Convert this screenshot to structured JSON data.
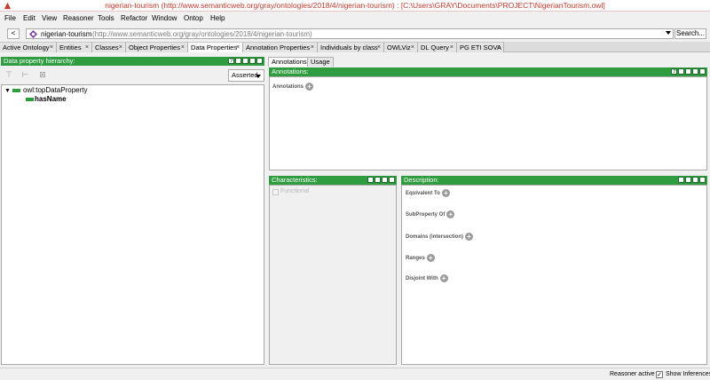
{
  "window": {
    "title": "nigerian-tourism (http://www.semanticweb.org/gray/ontologies/2018/4/nigerian-tourism)  : [C:\\Users\\GRAY\\Documents\\PROJECT\\NigerianTourism.owl]"
  },
  "menu": [
    "File",
    "Edit",
    "View",
    "Reasoner",
    "Tools",
    "Refactor",
    "Window",
    "Ontop",
    "Help"
  ],
  "address": {
    "back": "<",
    "ontology_name": "nigerian-tourism",
    "ontology_iri": "(http://www.semanticweb.org/gray/ontologies/2018/4/nigerian-tourism)",
    "search_label": "Search..."
  },
  "tabs": [
    {
      "label": "Active Ontology",
      "close": "×"
    },
    {
      "label": "Entities",
      "close": "×"
    },
    {
      "label": "Classes",
      "close": "×"
    },
    {
      "label": "Object Properties",
      "close": "×"
    },
    {
      "label": "Data Properties",
      "close": "×"
    },
    {
      "label": "Annotation Properties",
      "close": "×"
    },
    {
      "label": "Individuals by class",
      "close": "×"
    },
    {
      "label": "OWLViz",
      "close": "×"
    },
    {
      "label": "DL Query",
      "close": "×"
    },
    {
      "label": "PG ETI SOVA",
      "close": "×"
    }
  ],
  "left_panel": {
    "title": "Data property hierarchy:",
    "mode": "Asserted",
    "tree": {
      "root": "owl:topDataProperty",
      "children": [
        "hasName"
      ]
    }
  },
  "right_tabs": [
    "Annotations",
    "Usage"
  ],
  "annotations_panel": {
    "title": "Annotations:",
    "label": "Annotations"
  },
  "characteristics_panel": {
    "title": "Characteristics:",
    "functional": "Functional"
  },
  "description_panel": {
    "title": "Description:",
    "sections": [
      "Equivalent To",
      "SubProperty Of",
      "Domains (intersection)",
      "Ranges",
      "Disjoint With"
    ]
  },
  "status": {
    "reasoner": "Reasoner active",
    "show_inferences": "Show Inferences",
    "check": "✓"
  },
  "colors": {
    "header_green": "#2e9c3f",
    "title_red": "#c0392b"
  }
}
